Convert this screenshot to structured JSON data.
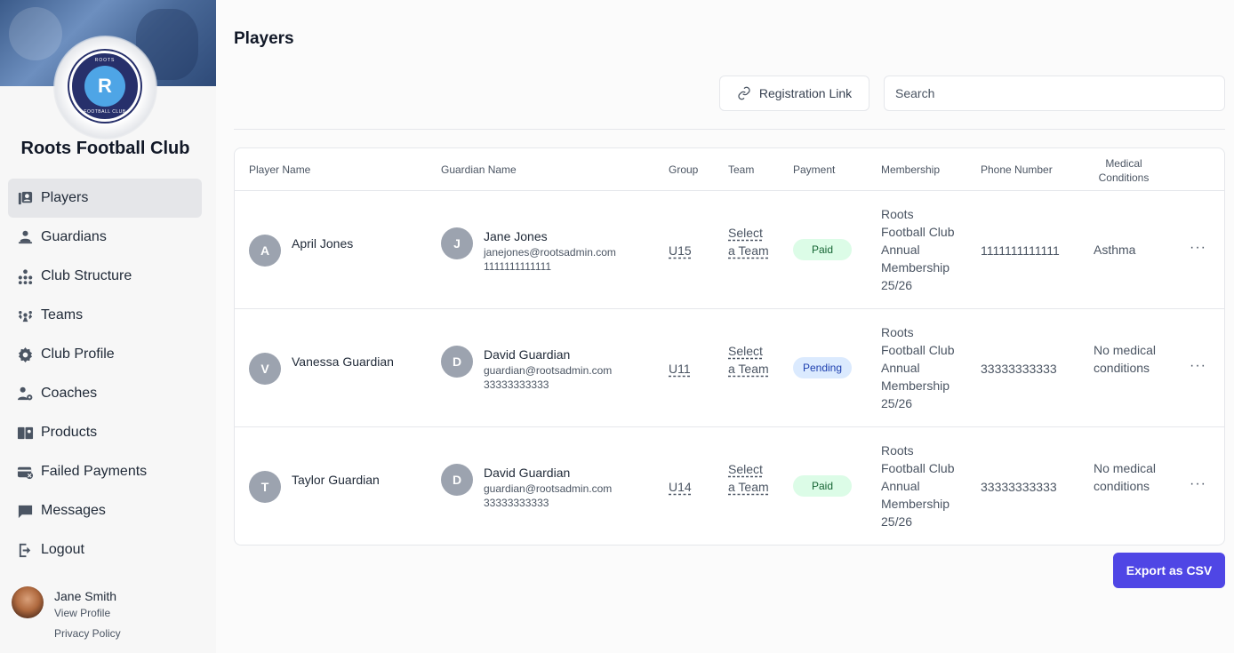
{
  "sidebar": {
    "club_name": "Roots Football Club",
    "logo": {
      "top_text": "ROOTS",
      "bottom_text": "FOOTBALL CLUB",
      "letter": "R"
    },
    "items": [
      {
        "label": "Players",
        "icon": "players-icon",
        "active": true
      },
      {
        "label": "Guardians",
        "icon": "guardian-icon"
      },
      {
        "label": "Club Structure",
        "icon": "hierarchy-icon"
      },
      {
        "label": "Teams",
        "icon": "teams-icon"
      },
      {
        "label": "Club Profile",
        "icon": "gear-icon"
      },
      {
        "label": "Coaches",
        "icon": "coach-icon"
      },
      {
        "label": "Products",
        "icon": "products-icon"
      },
      {
        "label": "Failed Payments",
        "icon": "failed-payment-icon"
      },
      {
        "label": "Messages",
        "icon": "message-icon"
      },
      {
        "label": "Logout",
        "icon": "logout-icon"
      }
    ],
    "user": {
      "name": "Jane Smith",
      "view_profile": "View Profile",
      "privacy": "Privacy Policy"
    }
  },
  "main": {
    "title": "Players",
    "registration_link": "Registration Link",
    "search_placeholder": "Search",
    "export_label": "Export as CSV",
    "columns": [
      "Player Name",
      "Guardian Name",
      "Group",
      "Team",
      "Payment",
      "Membership",
      "Phone Number",
      "Medical\nConditions"
    ],
    "rows": [
      {
        "initial": "A",
        "player": "April Jones",
        "g_initial": "J",
        "guardian": "Jane Jones",
        "g_email": "janejones@rootsadmin.com",
        "g_phone": "1111111111111",
        "group": "U15",
        "team": "Select a Team",
        "payment": "Paid",
        "membership": "Roots Football Club Annual Membership 25/26",
        "phone": "1111111111111",
        "medical": "Asthma",
        "actions": "···"
      },
      {
        "initial": "V",
        "player": "Vanessa Guardian",
        "g_initial": "D",
        "guardian": "David Guardian",
        "g_email": "guardian@rootsadmin.com",
        "g_phone": "33333333333",
        "group": "U11",
        "team": "Select a Team",
        "payment": "Pending",
        "membership": "Roots Football Club Annual Membership 25/26",
        "phone": "33333333333",
        "medical": "No medical conditions",
        "actions": "···"
      },
      {
        "initial": "T",
        "player": "Taylor Guardian",
        "g_initial": "D",
        "guardian": "David Guardian",
        "g_email": "guardian@rootsadmin.com",
        "g_phone": "33333333333",
        "group": "U14",
        "team": "Select a Team",
        "payment": "Paid",
        "membership": "Roots Football Club Annual Membership 25/26",
        "phone": "33333333333",
        "medical": "No medical conditions",
        "actions": "···"
      }
    ]
  },
  "colors": {
    "accent": "#4f46e5",
    "paid_bg": "#dcfce7",
    "pending_bg": "#dbeafe",
    "logo_navy": "#27306b"
  }
}
